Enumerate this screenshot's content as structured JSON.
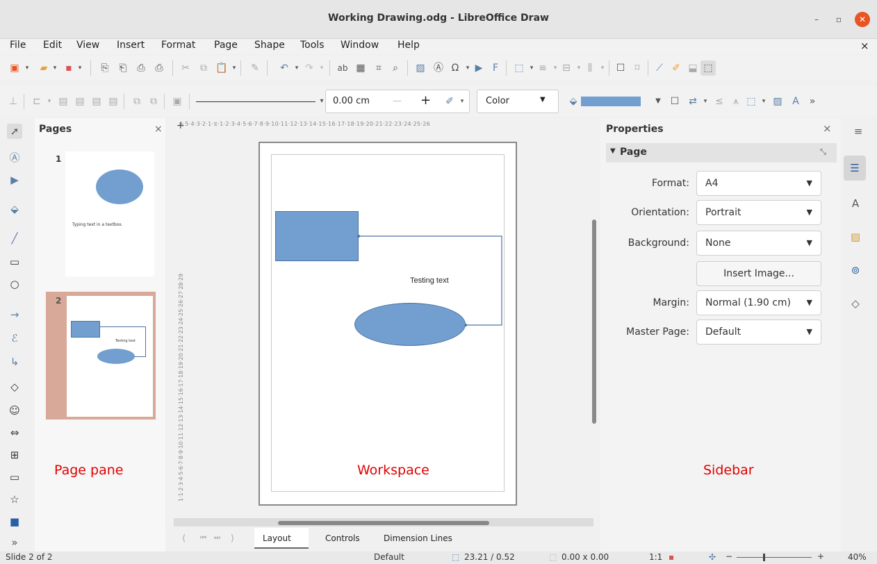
{
  "window": {
    "title": "Working Drawing.odg - LibreOffice Draw",
    "minimize": "–",
    "maximize": "▫",
    "close": "✕"
  },
  "menu": [
    "File",
    "Edit",
    "View",
    "Insert",
    "Format",
    "Page",
    "Shape",
    "Tools",
    "Window",
    "Help"
  ],
  "menu_close": "×",
  "toolbar2": {
    "line_width": "0.00 cm",
    "minus": "—",
    "plus": "+",
    "fill_type": "Color",
    "more": "»"
  },
  "pages_panel": {
    "title": "Pages",
    "close": "×",
    "page1_num": "1",
    "page1_text": "Typing text in a textbox.",
    "page2_num": "2",
    "page2_text": "Testing text"
  },
  "ruler": {
    "h_ticks": "6·5·4·3·2·1·⧖·1·2·3·4·5·6·7·8·9·10·11·12·13·14·15·16·17·18·19·20·21·22·23·24·25·26",
    "v_ticks": "1·1·2·3·4·5·6·7·8·9·10·11·12·13·14·15·16·17·18·19·20·21·22·23·24·25·26·27·28·29"
  },
  "canvas": {
    "text": "Testing text"
  },
  "labels": {
    "page_pane": "Page pane",
    "workspace": "Workspace",
    "sidebar": "Sidebar"
  },
  "tabs": [
    "Layout",
    "Controls",
    "Dimension Lines"
  ],
  "properties": {
    "title": "Properties",
    "close": "×",
    "section": "Page",
    "rows": [
      {
        "label": "Format:",
        "value": "A4"
      },
      {
        "label": "Orientation:",
        "value": "Portrait"
      },
      {
        "label": "Background:",
        "value": "None"
      }
    ],
    "insert_image": "Insert Image...",
    "margin_label": "Margin:",
    "margin_value": "Normal (1.90 cm)",
    "master_label": "Master Page:",
    "master_value": "Default"
  },
  "status": {
    "slide": "Slide 2 of 2",
    "master": "Default",
    "position": "23.21 / 0.52",
    "size": "0.00 x 0.00",
    "scale": "1:1",
    "zoom": "40%"
  },
  "colors": {
    "shape": "#729fcf",
    "accent": "#e95420",
    "label": "#e00000"
  }
}
